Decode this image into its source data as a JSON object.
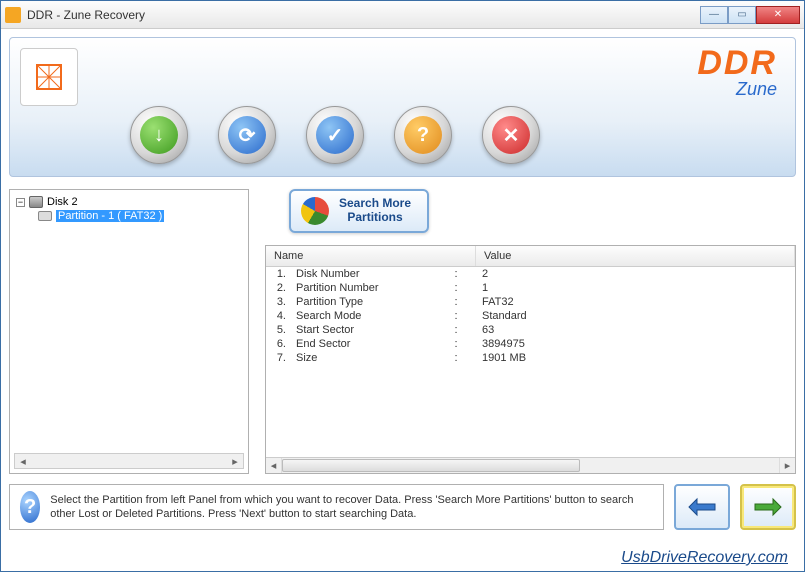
{
  "window": {
    "title": "DDR - Zune Recovery"
  },
  "brand": {
    "ddr": "DDR",
    "sub": "Zune"
  },
  "toolbar_icons": [
    "save-icon",
    "restore-icon",
    "check-icon",
    "help-icon",
    "cancel-icon"
  ],
  "tree": {
    "root": "Disk 2",
    "child": "Partition - 1 ( FAT32 )"
  },
  "search_button": {
    "line1": "Search More",
    "line2": "Partitions"
  },
  "table": {
    "header_name": "Name",
    "header_value": "Value",
    "rows": [
      {
        "idx": "1.",
        "name": "Disk Number",
        "value": "2"
      },
      {
        "idx": "2.",
        "name": "Partition Number",
        "value": "1"
      },
      {
        "idx": "3.",
        "name": "Partition Type",
        "value": "FAT32"
      },
      {
        "idx": "4.",
        "name": "Search Mode",
        "value": "Standard"
      },
      {
        "idx": "5.",
        "name": "Start Sector",
        "value": "63"
      },
      {
        "idx": "6.",
        "name": "End Sector",
        "value": "3894975"
      },
      {
        "idx": "7.",
        "name": "Size",
        "value": "1901 MB"
      }
    ]
  },
  "hint": "Select the Partition from left Panel from which you want to recover Data. Press 'Search More Partitions' button to search other Lost or Deleted Partitions. Press 'Next' button to start searching Data.",
  "footer_link": "UsbDriveRecovery.com"
}
